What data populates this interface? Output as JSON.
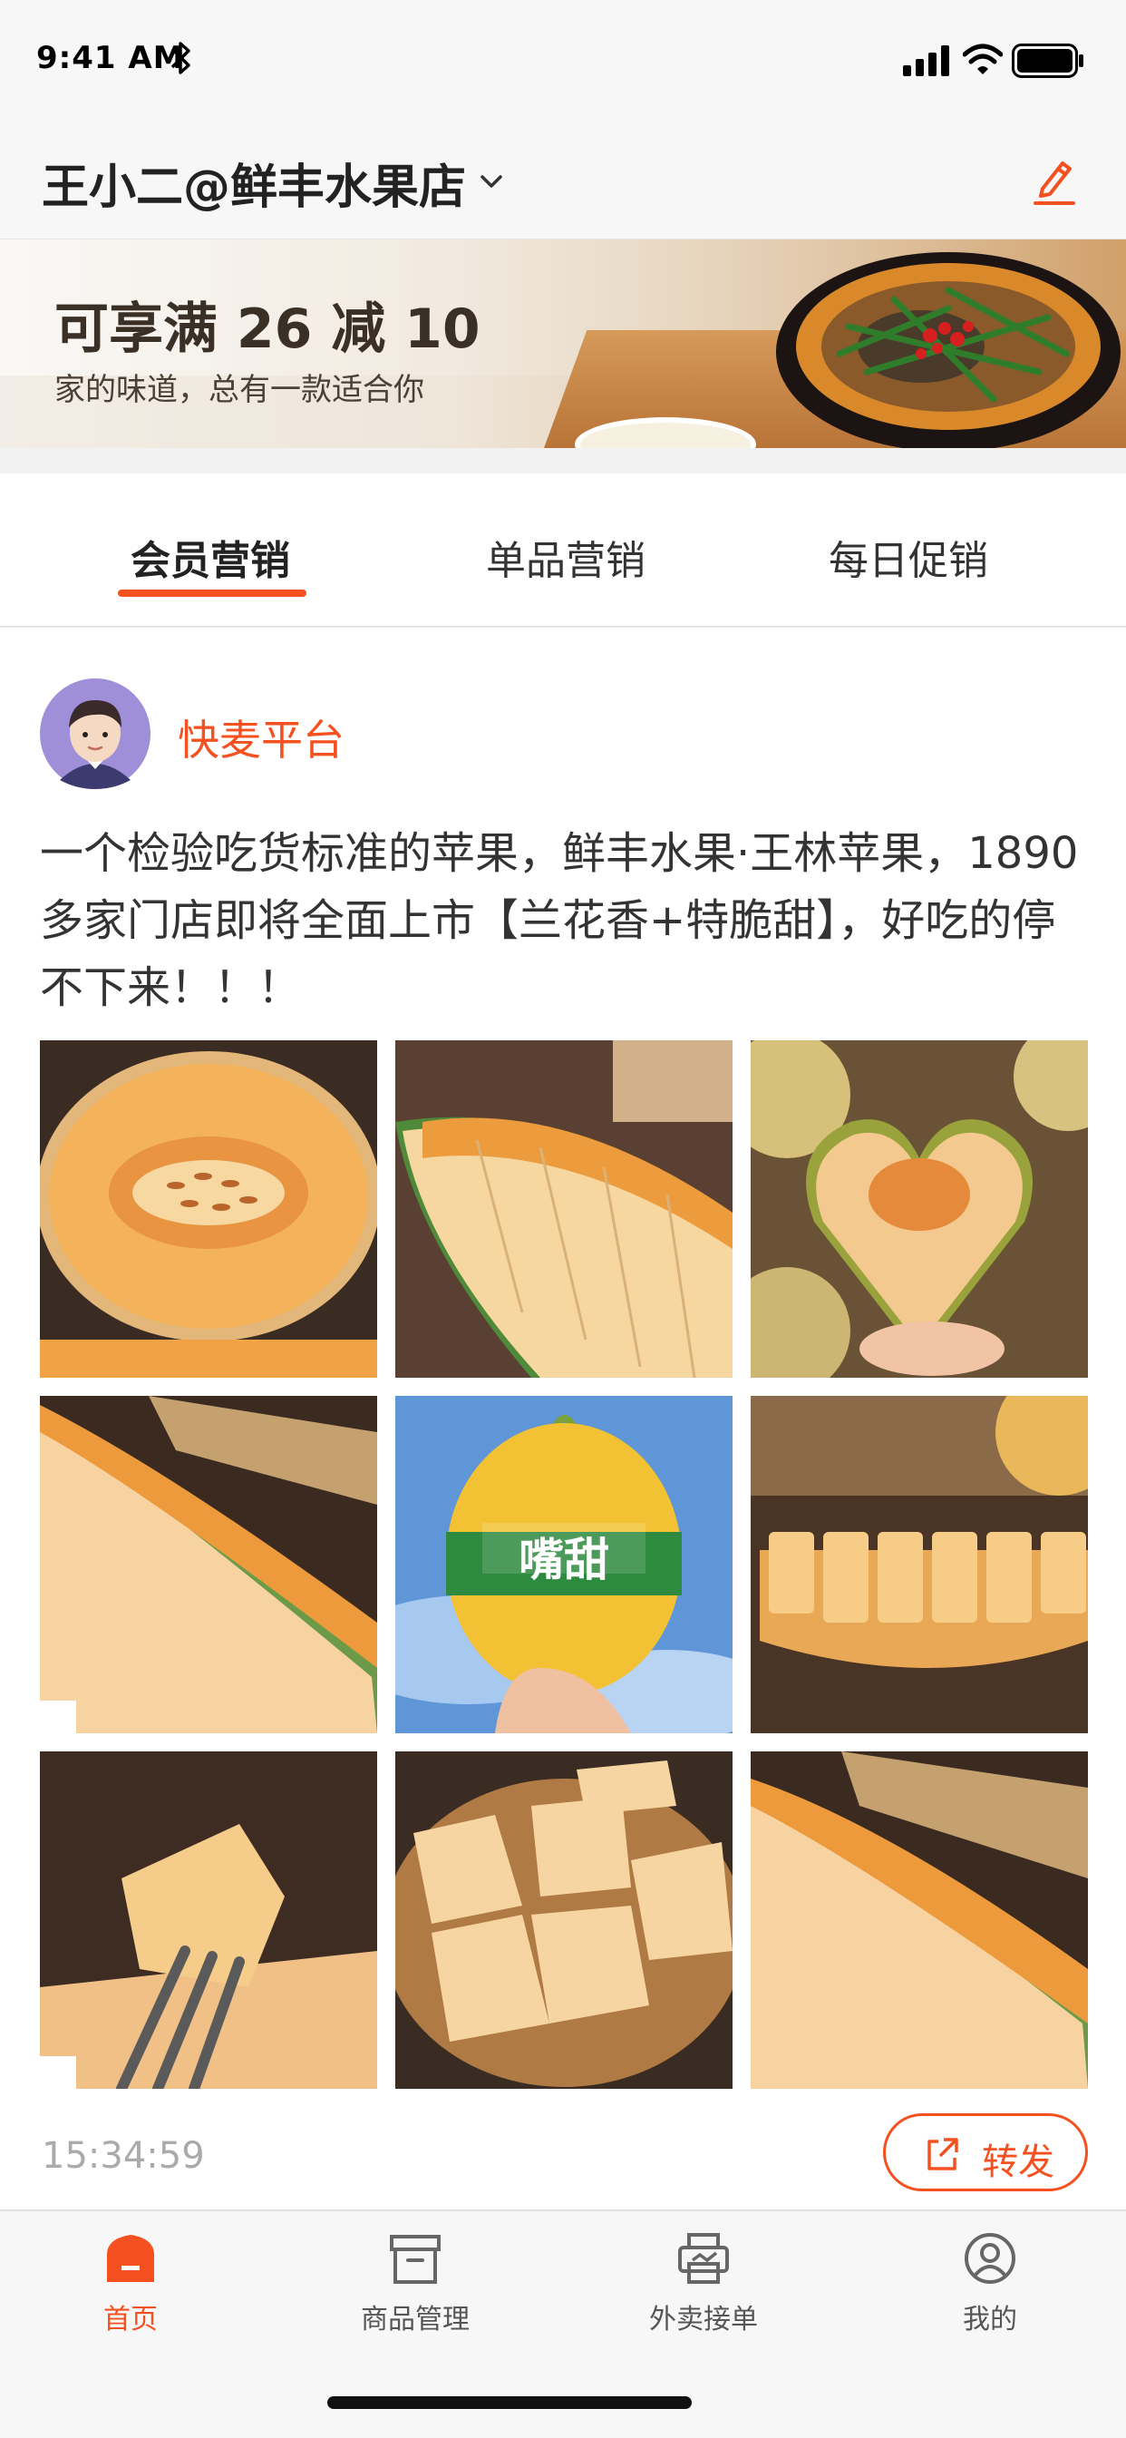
{
  "status_bar": {
    "time": "9:41 AM"
  },
  "header": {
    "shop_title": "王小二@鲜丰水果店"
  },
  "banner": {
    "heading": "可享满 26 减 10",
    "subtitle": "家的味道，总有一款适合你"
  },
  "tabs": [
    {
      "label": "会员营销",
      "active": true
    },
    {
      "label": "单品营销",
      "active": false
    },
    {
      "label": "每日促销",
      "active": false
    }
  ],
  "post": {
    "author": "快麦平台",
    "text": "一个检验吃货标准的苹果，鲜丰水果·王林苹果，1890多家门店即将全面上市【兰花香+特脆甜】，好吃的停不下来！！！",
    "photo_label": "嘴甜",
    "time": "15:34:59",
    "share_label": "转发"
  },
  "tab_bar": [
    {
      "label": "首页",
      "icon": "home-icon",
      "active": true
    },
    {
      "label": "商品管理",
      "icon": "box-icon",
      "active": false
    },
    {
      "label": "外卖接单",
      "icon": "printer-icon",
      "active": false
    },
    {
      "label": "我的",
      "icon": "user-icon",
      "active": false
    }
  ],
  "colors": {
    "accent": "#f5501f",
    "text": "#333333",
    "muted": "#aaaaaa"
  }
}
